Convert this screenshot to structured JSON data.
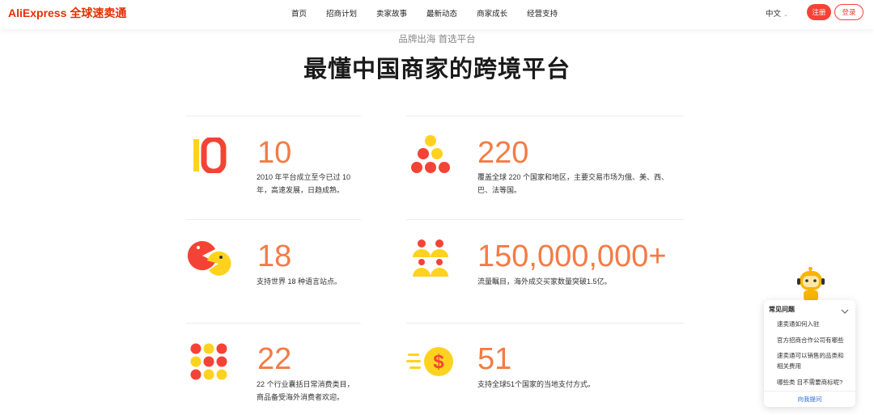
{
  "header": {
    "logo_brand": "AliExpress",
    "logo_cn": "全球速卖通",
    "nav": [
      "首页",
      "招商计划",
      "卖家故事",
      "最新动态",
      "商家成长",
      "经营支持"
    ],
    "language": "中文",
    "register_label": "注册",
    "login_label": "登录"
  },
  "hero": {
    "subtitle": "品牌出海 首选平台",
    "title": "最懂中国商家的跨境平台"
  },
  "stats": [
    {
      "number": "10",
      "desc_line1": "2010 年平台成立至今已过 10",
      "desc_line2": "年，高速发展，日趋成熟。",
      "icon": "ten-years-icon"
    },
    {
      "number": "220",
      "desc_line1": "覆盖全球 220 个国家和地区，主要交易市场为俄、美、西、",
      "desc_line2": "巴、法等国。",
      "icon": "countries-dots-icon"
    },
    {
      "number": "18",
      "desc_line1": "支持世界 18 种语言站点。",
      "desc_line2": "",
      "icon": "languages-pacman-icon"
    },
    {
      "number": "150,000,000+",
      "desc_line1": "流量瞩目，海外成交买家数量突破1.5亿。",
      "desc_line2": "",
      "icon": "buyers-people-icon"
    },
    {
      "number": "22",
      "desc_line1": "22 个行业囊括日常消费类目，",
      "desc_line2": "商品备受海外消费者欢迎。",
      "icon": "categories-grid-icon"
    },
    {
      "number": "51",
      "desc_line1": "支持全球51个国家的当地支付方式。",
      "desc_line2": "",
      "icon": "payment-coin-icon"
    }
  ],
  "help": {
    "title": "常见问题",
    "questions": [
      "速卖通如何入驻",
      "官方招商合作公司有哪些",
      "速卖通可以销售的品类和",
      "相关费用",
      "哪些类 目不需要商标呢?"
    ],
    "footer": "向我提问"
  },
  "colors": {
    "brand_red": "#e62e04",
    "accent_orange": "#f47b45",
    "red": "#f44336",
    "yellow": "#ffd21f"
  }
}
